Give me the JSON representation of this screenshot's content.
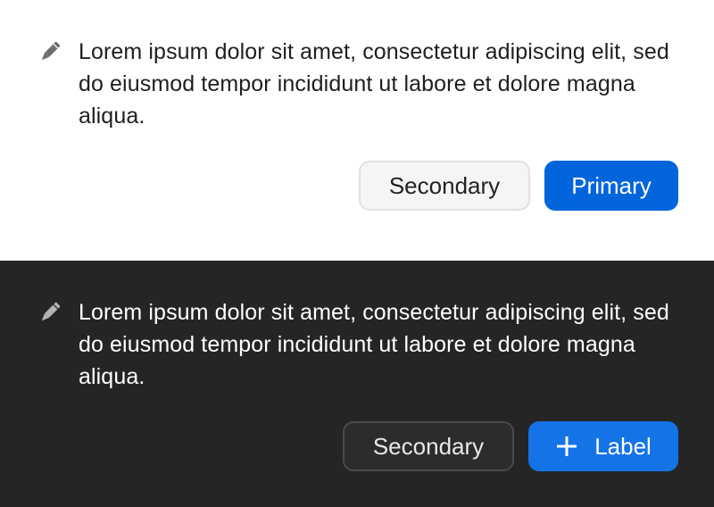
{
  "light_panel": {
    "message": "Lorem ipsum dolor sit amet, consectetur adipiscing elit, sed do eiusmod tempor incididunt ut labore et dolore magna aliqua.",
    "secondary_label": "Secondary",
    "primary_label": "Primary",
    "icon": "pencil-icon",
    "colors": {
      "background": "#ffffff",
      "text": "#1f1f1f",
      "primary": "#0265dc",
      "secondary_bg": "#f5f5f5"
    }
  },
  "dark_panel": {
    "message": "Lorem ipsum dolor sit amet, consectetur adipiscing elit, sed do eiusmod tempor incididunt ut labore et dolore magna aliqua.",
    "secondary_label": "Secondary",
    "primary_label": "Label",
    "icon": "pencil-icon",
    "primary_icon": "plus-icon",
    "colors": {
      "background": "#252525",
      "text": "#ffffff",
      "primary": "#1473e6",
      "secondary_bg": "#2c2c2c"
    }
  }
}
